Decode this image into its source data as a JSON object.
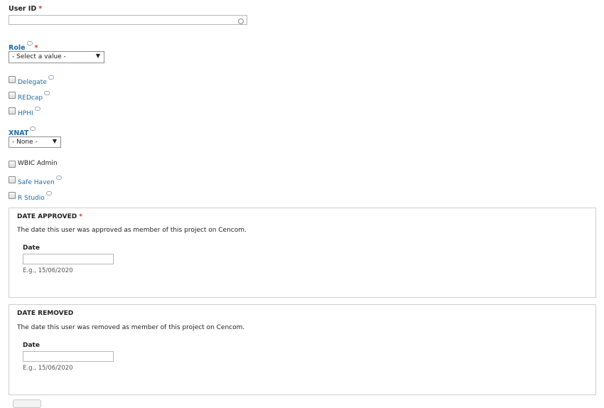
{
  "user_id": {
    "label": "User ID",
    "required_mark": "*",
    "value": ""
  },
  "role": {
    "label": "Role",
    "required_mark": "*",
    "selected": "- Select a value -"
  },
  "checkboxes_top": [
    {
      "label": "Delegate",
      "checked": false,
      "has_help": true
    },
    {
      "label": "REDcap",
      "checked": false,
      "has_help": true
    },
    {
      "label": "HPHI",
      "checked": false,
      "has_help": true
    }
  ],
  "xnat": {
    "label": "XNAT",
    "selected": "- None -"
  },
  "checkboxes_bottom": [
    {
      "label": "WBIC Admin",
      "checked": false,
      "has_help": false
    },
    {
      "label": "Safe Haven",
      "checked": false,
      "has_help": true
    },
    {
      "label": "R Studio",
      "checked": false,
      "has_help": true
    }
  ],
  "date_approved": {
    "title": "DATE APPROVED",
    "required_mark": "*",
    "description": "The date this user was approved as member of this project on Cencom.",
    "date_label": "Date",
    "value": "",
    "hint": "E.g., 15/06/2020"
  },
  "date_removed": {
    "title": "DATE REMOVED",
    "description": "The date this user was removed as member of this project on Cencom.",
    "date_label": "Date",
    "value": "",
    "hint": "E.g., 15/06/2020"
  },
  "colors": {
    "link": "#1f6aa5",
    "required": "#e0301e",
    "border": "#cfcfcf"
  },
  "icons": {
    "help": "speech-bubble-icon",
    "autocomplete": "throbber-icon",
    "dropdown": "triangle-down-icon"
  }
}
